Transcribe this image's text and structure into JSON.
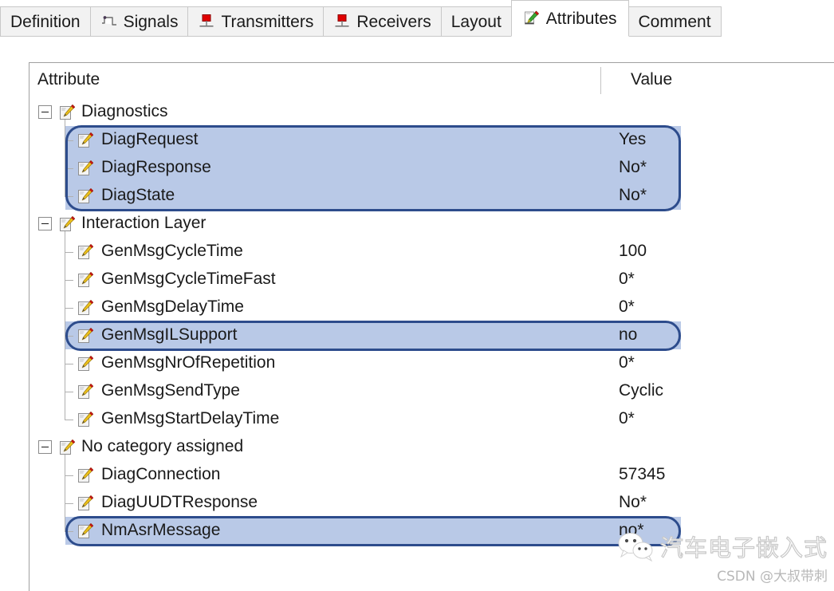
{
  "tabs": [
    {
      "label": "Definition",
      "icon": "none",
      "active": false
    },
    {
      "label": "Signals",
      "icon": "signal-waveform-icon",
      "active": false
    },
    {
      "label": "Transmitters",
      "icon": "network-node-icon",
      "active": false
    },
    {
      "label": "Receivers",
      "icon": "network-node-icon",
      "active": false
    },
    {
      "label": "Layout",
      "icon": "none",
      "active": false
    },
    {
      "label": "Attributes",
      "icon": "pencil-attribute-icon",
      "active": true
    },
    {
      "label": "Comment",
      "icon": "none",
      "active": false
    }
  ],
  "columns": {
    "attribute": "Attribute",
    "value": "Value"
  },
  "tree": [
    {
      "label": "Diagnostics",
      "value": "",
      "level": "group",
      "expanded": true,
      "icon": "note-pencil-icon"
    },
    {
      "label": "DiagRequest",
      "value": "Yes",
      "level": "child",
      "selected": true,
      "icon": "note-pencil-icon"
    },
    {
      "label": "DiagResponse",
      "value": "No*",
      "level": "child",
      "selected": true,
      "icon": "note-pencil-icon"
    },
    {
      "label": "DiagState",
      "value": "No*",
      "level": "child",
      "selected": true,
      "icon": "note-pencil-icon"
    },
    {
      "label": "Interaction Layer",
      "value": "",
      "level": "group",
      "expanded": true,
      "icon": "note-pencil-icon"
    },
    {
      "label": "GenMsgCycleTime",
      "value": "100",
      "level": "child",
      "selected": false,
      "icon": "note-pencil-icon"
    },
    {
      "label": "GenMsgCycleTimeFast",
      "value": "0*",
      "level": "child",
      "selected": false,
      "icon": "note-pencil-icon"
    },
    {
      "label": "GenMsgDelayTime",
      "value": "0*",
      "level": "child",
      "selected": false,
      "icon": "note-pencil-icon"
    },
    {
      "label": "GenMsgILSupport",
      "value": "no",
      "level": "child",
      "selected": true,
      "icon": "note-pencil-icon"
    },
    {
      "label": "GenMsgNrOfRepetition",
      "value": "0*",
      "level": "child",
      "selected": false,
      "icon": "note-pencil-icon"
    },
    {
      "label": "GenMsgSendType",
      "value": "Cyclic",
      "level": "child",
      "selected": false,
      "icon": "note-pencil-icon"
    },
    {
      "label": "GenMsgStartDelayTime",
      "value": "0*",
      "level": "child",
      "selected": false,
      "icon": "note-pencil-icon"
    },
    {
      "label": "No category assigned",
      "value": "",
      "level": "group",
      "expanded": true,
      "icon": "note-pencil-icon"
    },
    {
      "label": "DiagConnection",
      "value": "57345",
      "level": "child",
      "selected": false,
      "icon": "note-pencil-icon"
    },
    {
      "label": "DiagUUDTResponse",
      "value": "No*",
      "level": "child",
      "selected": false,
      "icon": "note-pencil-icon"
    },
    {
      "label": "NmAsrMessage",
      "value": "no*",
      "level": "child",
      "selected": true,
      "icon": "note-pencil-icon"
    }
  ],
  "annotations": [
    {
      "label": "diagnostics-selection-highlight",
      "first_row": 1,
      "last_row": 3
    },
    {
      "label": "genmsgilsupport-selection-highlight",
      "first_row": 8,
      "last_row": 8
    },
    {
      "label": "nmasrmessage-selection-highlight",
      "first_row": 15,
      "last_row": 15
    }
  ],
  "colors": {
    "selection_fill": "#b9c9e7",
    "selection_border": "#2d4c8c",
    "tab_inactive_bg": "#f2f2f2",
    "tab_active_bg": "#ffffff",
    "panel_border": "#a0a0a0",
    "tree_line": "#b0b0b0"
  },
  "watermark": {
    "icon": "wechat-icon",
    "brand": "汽车电子嵌入式",
    "credit": "CSDN @大叔带刺"
  }
}
